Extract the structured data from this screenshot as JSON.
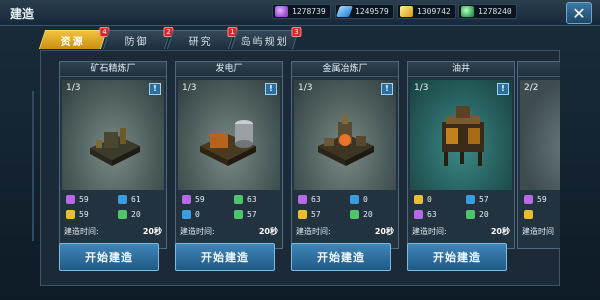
{
  "header": {
    "title": "建造",
    "resources": [
      {
        "icon": "purple-crystal-icon",
        "value": "1278739",
        "color": "#b86ae6"
      },
      {
        "icon": "blue-fuel-icon",
        "value": "1249579",
        "color": "#3a9de0"
      },
      {
        "icon": "gold-energy-icon",
        "value": "1309742",
        "color": "#e8c02a"
      },
      {
        "icon": "green-gem-icon",
        "value": "1278240",
        "color": "#4fc46a"
      }
    ],
    "close_label": "✕"
  },
  "tabs": [
    {
      "label": "资源",
      "badge": "4",
      "active": true
    },
    {
      "label": "防御",
      "badge": "2",
      "active": false
    },
    {
      "label": "研究",
      "badge": "1",
      "active": false
    },
    {
      "label": "岛屿规划",
      "badge": "3",
      "active": false
    }
  ],
  "cards": [
    {
      "name": "矿石精炼厂",
      "level": "1/3",
      "costs": [
        "59",
        "61",
        "59",
        "20"
      ],
      "time_label": "建造时间:",
      "time": "20秒",
      "button": "开始建造"
    },
    {
      "name": "发电厂",
      "level": "1/3",
      "costs": [
        "59",
        "63",
        "0",
        "57"
      ],
      "time_label": "建造时间:",
      "time": "20秒",
      "button": "开始建造"
    },
    {
      "name": "金属冶炼厂",
      "level": "1/3",
      "costs": [
        "63",
        "0",
        "57",
        "20"
      ],
      "time_label": "建造时间:",
      "time": "20秒",
      "button": "开始建造"
    },
    {
      "name": "油井",
      "level": "1/3",
      "costs": [
        "0",
        "57",
        "63",
        "20"
      ],
      "time_label": "建造时间:",
      "time": "20秒",
      "button": "开始建造"
    },
    {
      "name": "",
      "level": "2/2",
      "costs": [
        "59",
        "",
        "",
        ""
      ],
      "time_label": "建造时间",
      "time": "",
      "button": ""
    }
  ],
  "cost_icons": [
    {
      "icon": "purple-crystal-icon",
      "color": "#b86ae6"
    },
    {
      "icon": "blue-fuel-icon",
      "color": "#3a9de0"
    },
    {
      "icon": "gold-energy-icon",
      "color": "#e8c02a"
    },
    {
      "icon": "green-gem-icon",
      "color": "#4fc46a"
    }
  ]
}
